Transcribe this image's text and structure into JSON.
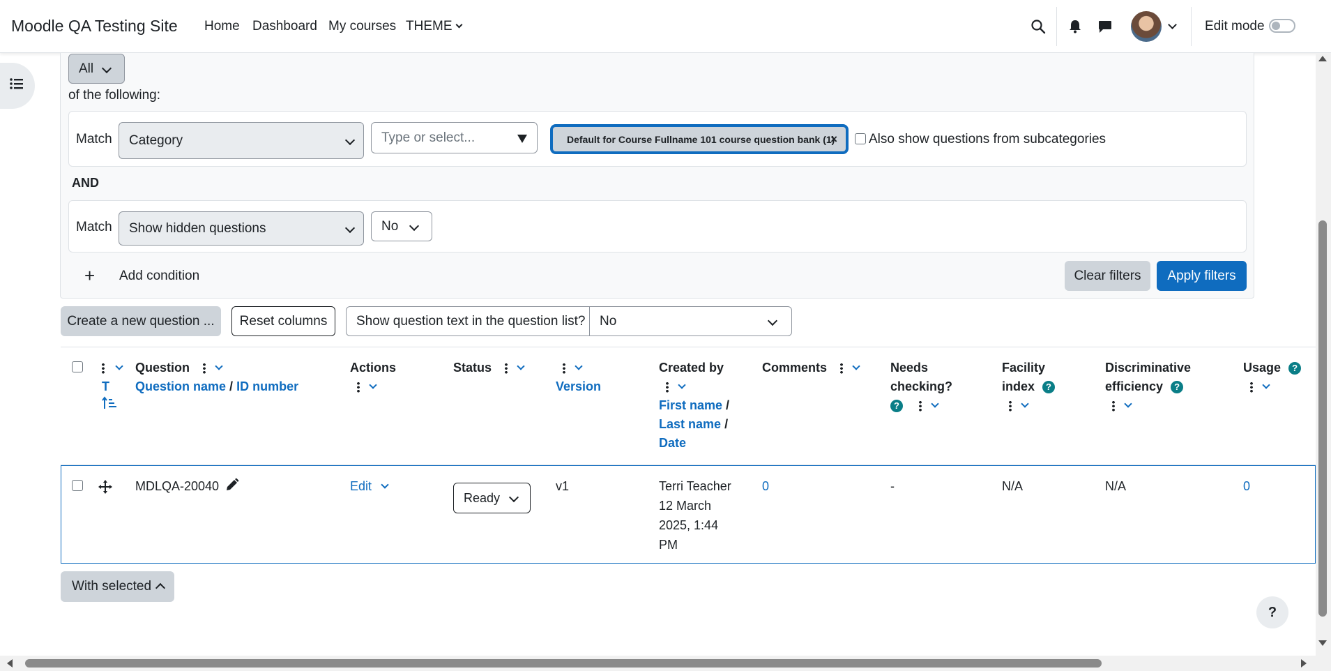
{
  "navbar": {
    "brand": "Moodle QA Testing Site",
    "links": [
      "Home",
      "Dashboard",
      "My courses",
      "THEME"
    ],
    "edit_mode_label": "Edit mode"
  },
  "filters": {
    "join_value": "All",
    "of_following": "of the following:",
    "match_label": "Match",
    "condition1_type": "Category",
    "condition1_placeholder": "Type or select...",
    "condition1_tag": "Default for Course Fullname 101 course question bank (1)",
    "subcategories_label": "Also show questions from subcategories",
    "and_label": "AND",
    "condition2_type": "Show hidden questions",
    "condition2_value": "No",
    "add_condition": "Add condition",
    "clear_filters": "Clear filters",
    "apply_filters": "Apply filters"
  },
  "toolbar": {
    "create_question": "Create a new question ...",
    "reset_columns": "Reset columns",
    "show_text_label": "Show question text in the question list?",
    "show_text_value": "No"
  },
  "table": {
    "headers": {
      "type_letter": "T",
      "question": "Question",
      "question_name": "Question name",
      "slash": "/",
      "id_number": "ID number",
      "actions": "Actions",
      "status": "Status",
      "version": "Version",
      "created_by": "Created by",
      "first_name": "First name",
      "last_name": "Last name",
      "date": "Date",
      "comments": "Comments",
      "needs_checking_1": "Needs",
      "needs_checking_2": "checking?",
      "facility_1": "Facility",
      "facility_2": "index",
      "discrim_1": "Discriminative",
      "discrim_2": "efficiency",
      "usage": "Usage"
    },
    "rows": [
      {
        "name": "MDLQA-20040",
        "action": "Edit",
        "status": "Ready",
        "version": "v1",
        "creator": "Terri Teacher",
        "date_1": "12 March",
        "date_2": "2025, 1:44",
        "date_3": "PM",
        "comments": "0",
        "needs_checking": "-",
        "facility": "N/A",
        "discriminative": "N/A",
        "usage": "0"
      }
    ]
  },
  "footer": {
    "with_selected": "With selected",
    "help": "?"
  }
}
